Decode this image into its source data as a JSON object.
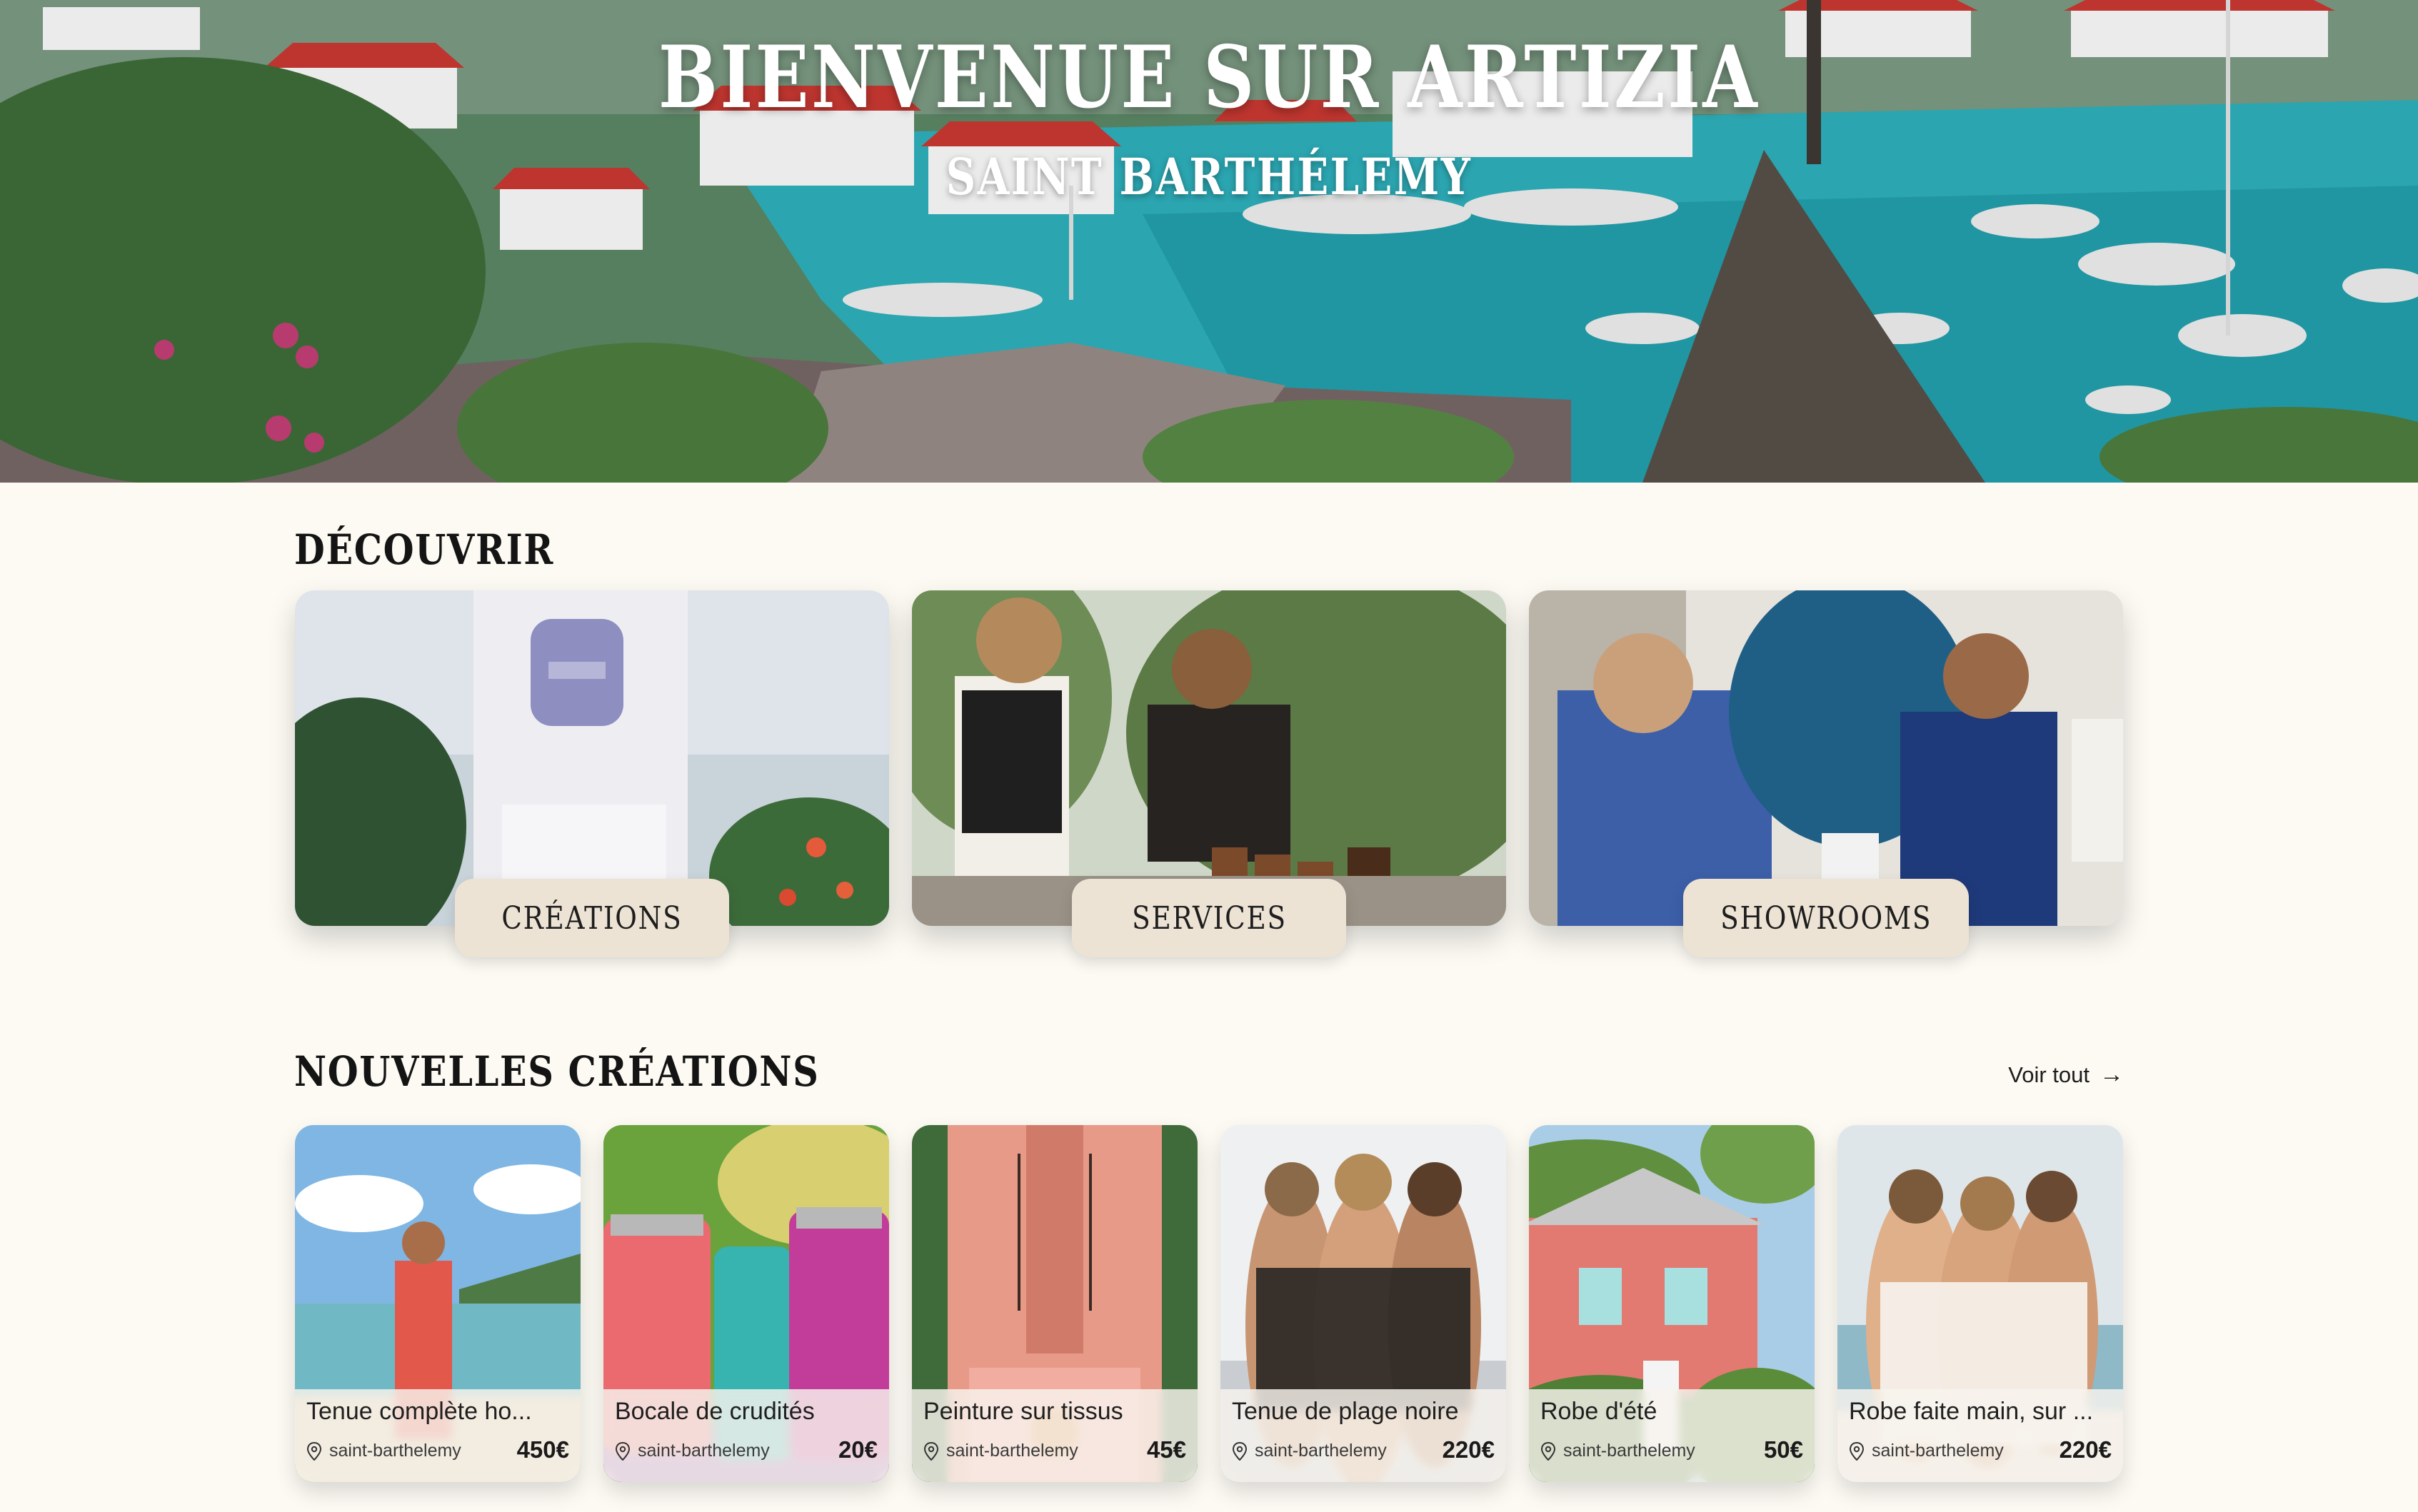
{
  "hero": {
    "title": "BIENVENUE SUR ARTIZIA",
    "subtitle": "SAINT BARTHÉLEMY"
  },
  "discover": {
    "title": "DÉCOUVRIR",
    "cards": [
      {
        "label": "CRÉATIONS"
      },
      {
        "label": "SERVICES"
      },
      {
        "label": "SHOWROOMS"
      }
    ]
  },
  "new_creations": {
    "title": "NOUVELLES CRÉATIONS",
    "see_all": "Voir tout",
    "see_all_icon": "arrow-right-icon",
    "products": [
      {
        "title": "Tenue complète ho...",
        "location": "saint-barthelemy",
        "price": "450€"
      },
      {
        "title": "Bocale de crudités",
        "location": "saint-barthelemy",
        "price": "20€"
      },
      {
        "title": "Peinture sur tissus",
        "location": "saint-barthelemy",
        "price": "45€"
      },
      {
        "title": "Tenue de plage noire",
        "location": "saint-barthelemy",
        "price": "220€"
      },
      {
        "title": "Robe d'été",
        "location": "saint-barthelemy",
        "price": "50€"
      },
      {
        "title": "Robe faite main, sur ...",
        "location": "saint-barthelemy",
        "price": "220€"
      }
    ]
  },
  "colors": {
    "page_background": "#fcfaf3",
    "tag_background": "#ece3d4",
    "text": "#1c1c1c"
  }
}
